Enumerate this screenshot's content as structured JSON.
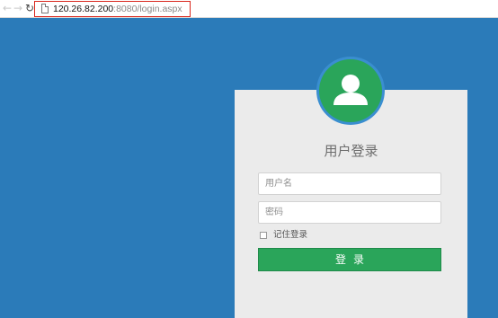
{
  "browser": {
    "back_icon": "arrow-left-icon",
    "forward_icon": "arrow-right-icon",
    "reload_icon": "reload-icon",
    "page_icon": "page-icon",
    "url_host": "120.26.82.200",
    "url_rest": ":8080/login.aspx"
  },
  "login": {
    "title": "用户登录",
    "username_placeholder": "用户名",
    "password_placeholder": "密码",
    "remember_label": "记住登录",
    "remember_checked": false,
    "submit_label": "登录",
    "avatar_icon": "user-icon"
  },
  "colors": {
    "background": "#2b7bb9",
    "panel": "#ebebeb",
    "accent_green": "#2aa55a",
    "highlight_red": "#d9261c"
  }
}
